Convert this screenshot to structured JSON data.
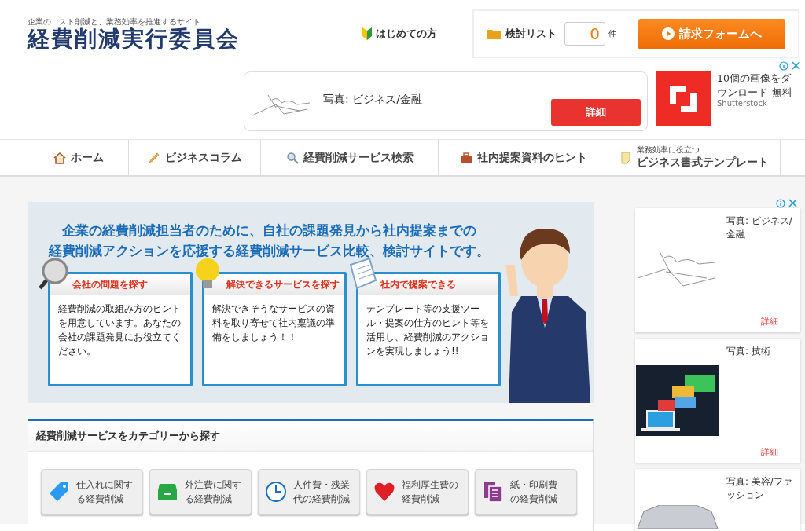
{
  "header": {
    "tagline": "企業のコスト削減と、業務効率を推進するサイト",
    "logo": "経費削減実行委員会",
    "beginner_link": "はじめての方",
    "review_list": {
      "label": "検討リスト",
      "count": "0",
      "unit": "件"
    },
    "request_button": "請求フォームへ"
  },
  "top_ad": {
    "caption": "写真: ビジネス/金融",
    "button": "詳細",
    "promo": "10個の画像をダウンロード-無料",
    "brand": "Shutterstock"
  },
  "nav": [
    {
      "kind": "home",
      "label": "ホーム"
    },
    {
      "kind": "pencil",
      "label": "ビジネスコラム"
    },
    {
      "kind": "search",
      "label": "経費削減サービス検索"
    },
    {
      "kind": "briefcase",
      "label": "社内提案資料のヒント"
    },
    {
      "kind": "memo",
      "label": "ビジネス書式テンプレート",
      "sublabel": "業務効率に役立つ"
    }
  ],
  "hero": {
    "headline": [
      "企業の経費削減担当者のために、自社の課題発見から社内提案までの",
      "経費削減アクションを応援する経費削減サービス比較、検討サイトです。"
    ],
    "cards": [
      {
        "kind": "magnifier",
        "title": "会社の問題を探す",
        "text": "経費削減の取組み方のヒントを用意しています。あなたの会社の課題発見にお役立てください。"
      },
      {
        "kind": "bulb",
        "title": "解決できるサービスを探す",
        "text": "解決できそうなサービスの資料を取り寄せて社内稟議の準備をしましょう！！"
      },
      {
        "kind": "document",
        "title": "社内で提案できる",
        "text": "テンプレート等の支援ツール・提案の仕方のヒント等を活用し、経費削減のアクションを実現しましょう!!"
      }
    ]
  },
  "category_panel": {
    "title": "経費削減サービスをカテゴリーから探す",
    "categories": [
      {
        "kind": "tag",
        "lines": [
          "仕入れに関す",
          "る経費削減"
        ]
      },
      {
        "kind": "tray",
        "lines": [
          "外注費に関す",
          "る経費削減"
        ]
      },
      {
        "kind": "clock",
        "lines": [
          "人件費・残業",
          "代の経費削減"
        ]
      },
      {
        "kind": "heart",
        "lines": [
          "福利厚生費の",
          "経費削減"
        ]
      },
      {
        "kind": "paper",
        "lines": [
          "紙・印刷費",
          "の経費削減"
        ]
      }
    ]
  },
  "side_ads": [
    {
      "kind": "sketch",
      "caption": "写真: ビジネス/金融",
      "button": "詳細"
    },
    {
      "kind": "envelopes",
      "caption": "写真: 技術",
      "button": "詳細"
    },
    {
      "kind": "diamond",
      "caption": "写真: 美容/ファッション"
    }
  ]
}
